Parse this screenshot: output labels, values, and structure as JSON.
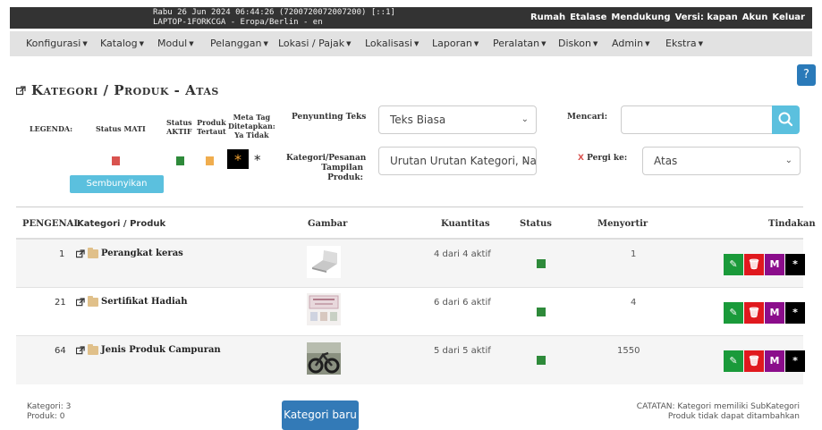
{
  "topbar": {
    "info_line1": "Rabu 26 Jun 2024 06:44:26 (7200720072007200) [::1]",
    "info_line2": "LAPTOP-1FORKCGA - Eropa/Berlin - en",
    "links": [
      "Rumah",
      "Etalase",
      "Mendukung",
      "Versi: kapan",
      "Akun",
      "Keluar"
    ]
  },
  "menu": [
    "Konfigurasi",
    "Katalog",
    "Modul",
    "Pelanggan",
    "Lokasi / Pajak",
    "Lokalisasi",
    "Laporan",
    "Peralatan",
    "Diskon",
    "Admin",
    "Ekstra"
  ],
  "help_label": "?",
  "page_title": "Kategori / Produk - Atas",
  "legend": {
    "label": "LEGENDA:",
    "status_off": "Status MATI",
    "status_on_l1": "Status",
    "status_on_l2": "AKTIF",
    "featured_l1": "Produk",
    "featured_l2": "Tertaut",
    "meta_l1": "Meta Tag",
    "meta_l2": "Ditetapkan:",
    "meta_l3": "Ya Tidak",
    "colors": {
      "off": "#d9534f",
      "on": "#2e8a3a",
      "linked": "#f0ad4e"
    },
    "hide_images_btn": "Sembunyikan Gambar"
  },
  "filters": {
    "editor_label": "Penyunting Teks",
    "editor_value": "Teks Biasa",
    "search_label": "Mencari:",
    "search_value": "",
    "sort_label_l1": "Kategori/Pesanan",
    "sort_label_l2": "Tampilan",
    "sort_label_l3": "Produk:",
    "sort_value": "Urutan Urutan Kategori, Na",
    "goto_x": "X",
    "goto_label": "Pergi ke:",
    "goto_value": "Atas"
  },
  "table": {
    "headers": {
      "id": "PENGENAL",
      "name": "Kategori / Produk",
      "image": "Gambar",
      "qty": "Kuantitas",
      "status": "Status",
      "sort": "Menyortir",
      "actions": "Tindakan"
    },
    "rows": [
      {
        "id": "1",
        "name": "Perangkat keras",
        "qty": "4 dari 4 aktif",
        "sort": "1",
        "image": "laptop-thumbnail"
      },
      {
        "id": "21",
        "name": "Sertifikat Hadiah",
        "qty": "6 dari 6 aktif",
        "sort": "4",
        "image": "gift-certificate-thumbnail"
      },
      {
        "id": "64",
        "name": "Jenis Produk Campuran",
        "qty": "5 dari 5 aktif",
        "sort": "1550",
        "image": "mixed-products-thumbnail"
      }
    ],
    "action_labels": {
      "edit": "✎",
      "delete": "🗑",
      "move": "M",
      "meta": "*"
    },
    "action_colors": {
      "edit": "#1a9a3a",
      "delete": "#e0191e",
      "move": "#8b0d8b",
      "meta": "#000000"
    }
  },
  "footer": {
    "categories": "Kategori: 3",
    "products": "Produk: 0",
    "new_category_btn": "Kategori baru",
    "note_l1": "CATATAN: Kategori memiliki SubKategori",
    "note_l2": "Produk tidak dapat ditambahkan"
  }
}
